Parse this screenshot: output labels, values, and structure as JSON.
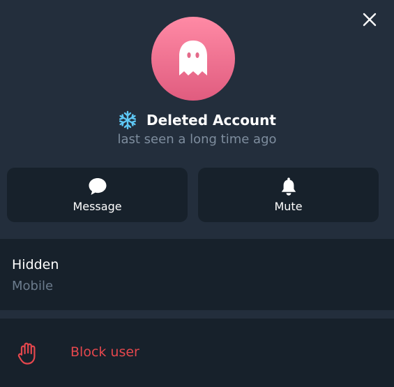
{
  "profile": {
    "name": "Deleted Account",
    "status": "last seen a long time ago"
  },
  "actions": {
    "message_label": "Message",
    "mute_label": "Mute"
  },
  "info": {
    "value": "Hidden",
    "label": "Mobile"
  },
  "block": {
    "label": "Block user"
  },
  "icons": {
    "close": "close-icon",
    "avatar": "ghost-icon",
    "name_badge": "snowflake-icon",
    "message": "chat-bubble-icon",
    "mute": "bell-icon",
    "block": "hand-icon"
  },
  "colors": {
    "background": "#17212b",
    "header": "#232e3c",
    "avatar_top": "#ff8aa5",
    "avatar_bottom": "#e05c7f",
    "name": "#ffffff",
    "status": "#7e8d9e",
    "secondary_label": "#6c7c8d",
    "danger": "#e5474d",
    "snowflake": "#5ec8f5"
  }
}
